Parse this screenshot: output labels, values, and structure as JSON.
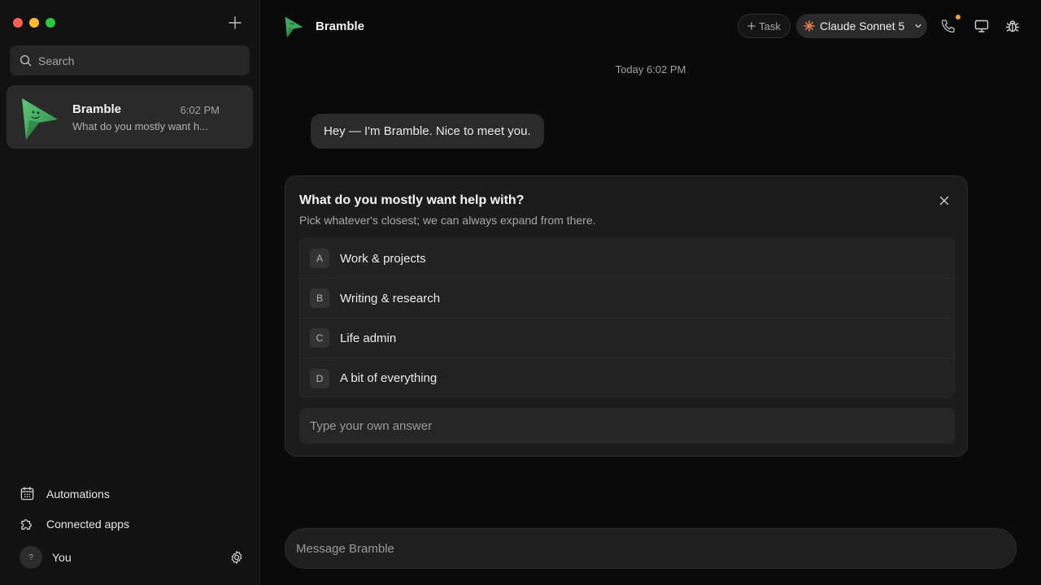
{
  "sidebar": {
    "search_placeholder": "Search",
    "conversation": {
      "name": "Bramble",
      "time": "6:02 PM",
      "preview": "What do you mostly want h..."
    },
    "links": [
      {
        "label": "Automations",
        "icon": "calendar-icon"
      },
      {
        "label": "Connected apps",
        "icon": "puzzle-icon"
      }
    ],
    "user": {
      "avatar_text": "?",
      "name": "You"
    }
  },
  "header": {
    "title": "Bramble",
    "task_label": "Task",
    "model_label": "Claude Sonnet 5",
    "notification_color": "#f0a23a"
  },
  "chat": {
    "timestamp": "Today 6:02 PM",
    "message": "Hey — I'm Bramble. Nice to meet you.",
    "question": {
      "title": "What do you mostly want help with?",
      "subtitle": "Pick whatever's closest; we can always expand from there.",
      "options": [
        {
          "key": "A",
          "label": "Work & projects"
        },
        {
          "key": "B",
          "label": "Writing & research"
        },
        {
          "key": "C",
          "label": "Life admin"
        },
        {
          "key": "D",
          "label": "A bit of everything"
        }
      ],
      "own_answer_placeholder": "Type your own answer"
    },
    "composer_placeholder": "Message Bramble"
  },
  "colors": {
    "brand_green": "#3fa65c",
    "background": "#0a0a0a"
  }
}
